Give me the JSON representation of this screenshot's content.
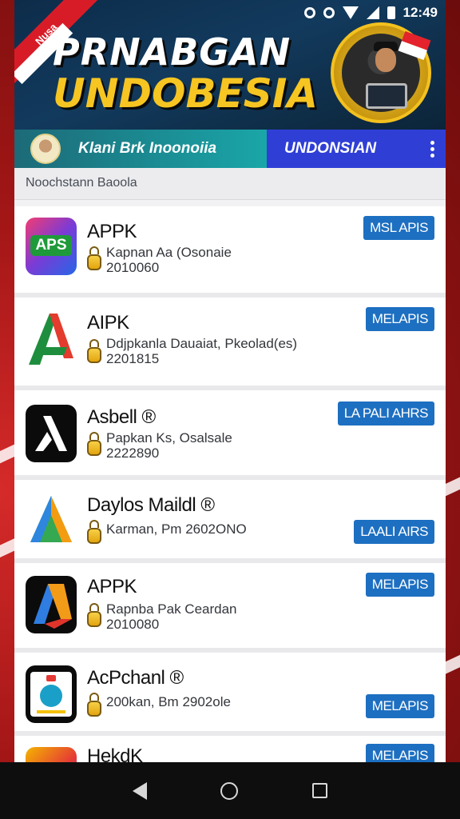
{
  "status_bar": {
    "time": "12:49"
  },
  "banner": {
    "ribbon_text": "Nusa",
    "title_line1": "PRNABGAN",
    "title_line2": "UNDOBESIA"
  },
  "channel": {
    "name": "Klani Brk Inoonoiia",
    "tag": "UNDONSIAN"
  },
  "section_label": "Noochstann Baoola",
  "apps": [
    {
      "name": "APPK",
      "detail": "Kapnan Aa (Osonaie",
      "date": "2010060",
      "button": "MSL APIS",
      "icon": "aps-icon"
    },
    {
      "name": "AIPK",
      "detail": "Ddjpkanla Dauaiat, Pkeolad(es)",
      "date": "2201815",
      "button": "MELAPIS",
      "icon": "a-logo-icon"
    },
    {
      "name": "Asbell ®",
      "detail": "Papkan Ks, Osalsale",
      "date": "2222890",
      "button": "LA PALI AHRS",
      "icon": "lambda-icon"
    },
    {
      "name": "Daylos Maildl ®",
      "detail": "Karman, Pm 2602ONO",
      "date": "",
      "button": "LAALI AIRS",
      "icon": "triangle-a-icon"
    },
    {
      "name": "APPK",
      "detail": "Rapnba Pak Ceardan",
      "date": "2010080",
      "button": "MELAPIS",
      "icon": "cube-a-icon"
    },
    {
      "name": "AcPchanl ®",
      "detail": "200kan, Bm 2902ole",
      "date": "",
      "button": "MELAPIS",
      "icon": "badge-icon"
    },
    {
      "name": "HekdK",
      "detail": "",
      "date": "",
      "button": "MELAPIS",
      "icon": "folder-icon"
    }
  ],
  "colors": {
    "button_blue": "#1d6fc1",
    "banner_gold": "#f6c522",
    "channel_blue": "#2f3fd6",
    "brand_red": "#d81c27"
  }
}
